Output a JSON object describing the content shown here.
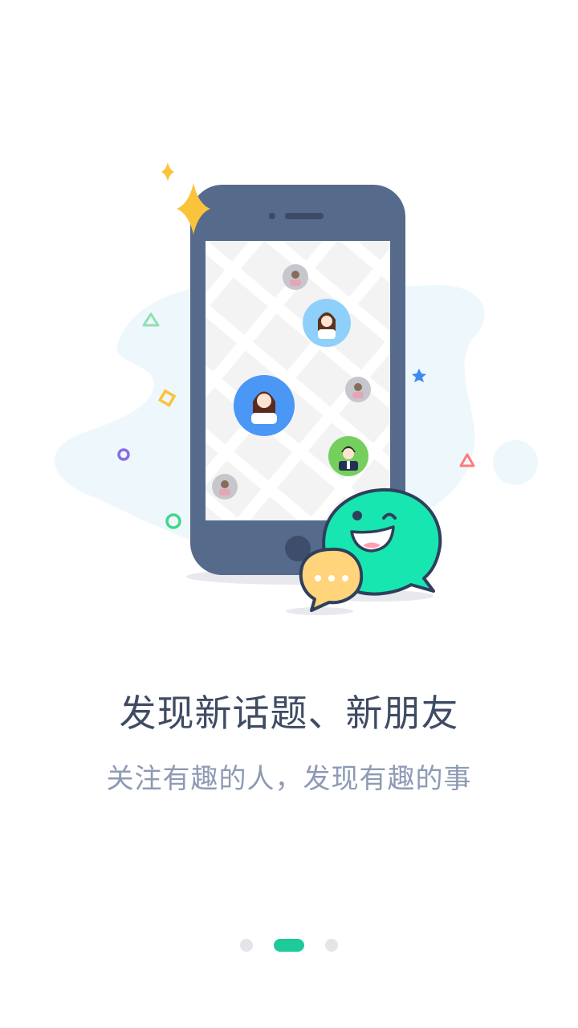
{
  "onboarding": {
    "title": "发现新话题、新朋友",
    "subtitle": "关注有趣的人，发现有趣的事"
  },
  "pager": {
    "page_count": 3,
    "current_page": 2
  },
  "colors": {
    "accent": "#1ec99a",
    "title": "#3f4b63",
    "subtitle": "#8e9ab4",
    "dot_inactive": "#e3e5e8",
    "phone_body": "#566a8c",
    "blob": "#eef8fc",
    "chat_green": "#18e6b0",
    "chat_yellow": "#ffd47a",
    "avatar_blue": "#4a97f5",
    "avatar_green": "#75cf5d",
    "avatar_lightblue": "#8fd0fa",
    "sparkle": "#fbc33b"
  },
  "icons": {
    "sparkle": "sparkle-icon",
    "star": "star-icon",
    "triangle": "triangle-icon",
    "ring": "ring-icon",
    "square": "square-icon",
    "chat": "chat-bubble-icon"
  }
}
